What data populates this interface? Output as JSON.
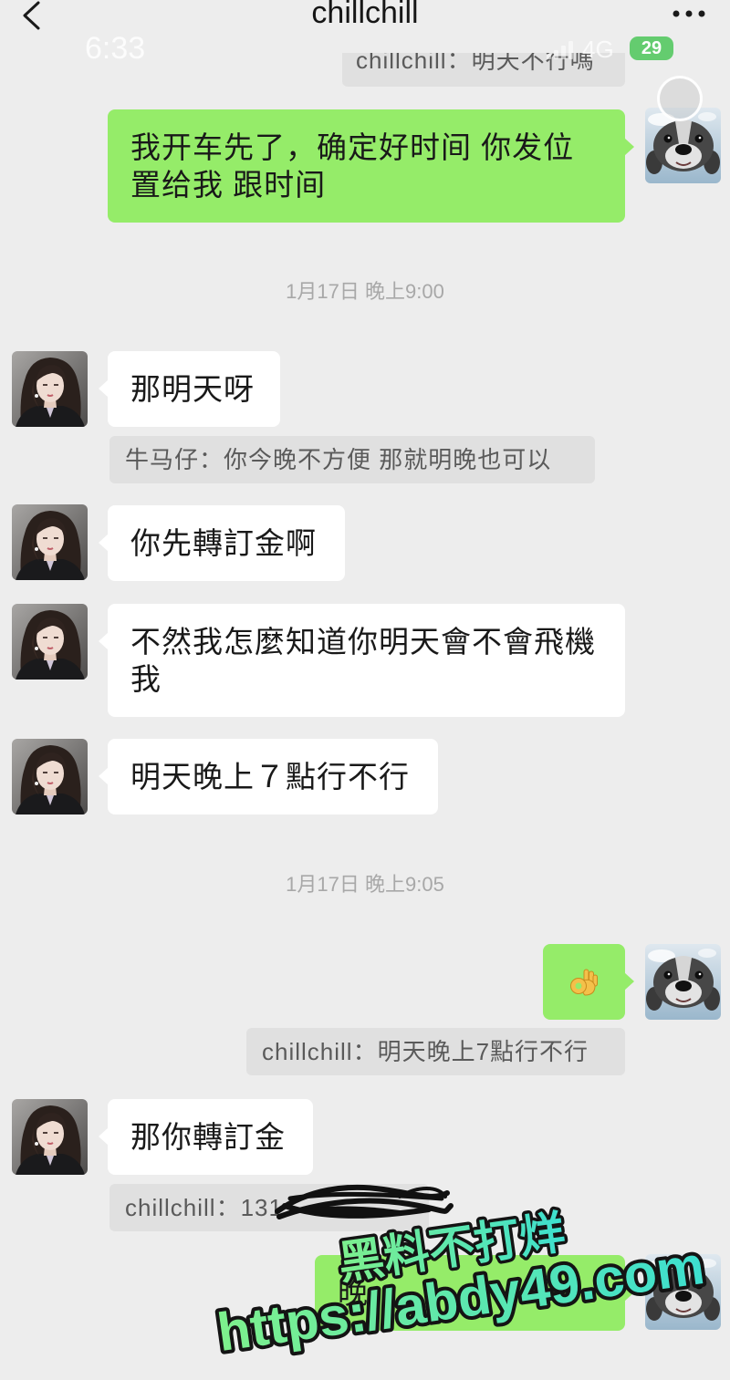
{
  "status_bar": {
    "time": "6:33",
    "network": "4G",
    "battery": "29",
    "signal_icon": "signal-bars-icon",
    "battery_icon": "battery-icon"
  },
  "header": {
    "title": "chillchill",
    "back_icon": "chevron-left-icon",
    "more_icon": "more-dots-icon"
  },
  "colors": {
    "background": "#ededed",
    "outgoing_bubble": "#95ec69",
    "incoming_bubble": "#ffffff",
    "quote_background": "#e0e0e0",
    "quote_text": "#5a5a5a",
    "timestamp_text": "#a8a8a8",
    "watermark_fill_start": "#7ef08c",
    "watermark_fill_end": "#3ddfcf",
    "watermark_outline": "#141414"
  },
  "messages": [
    {
      "quote": "chillchill：明天不行嗎"
    },
    {
      "outgoing": "我开车先了，确定好时间 你发位\n置给我 跟时间"
    },
    {
      "timestamp": "1月17日 晚上9:00"
    },
    {
      "incoming": "那明天呀"
    },
    {
      "quote": "牛马仔：你今晚不方便 那就明晚也可以"
    },
    {
      "incoming": "你先轉訂金啊"
    },
    {
      "incoming": "不然我怎麼知道你明天會不會飛機\n我"
    },
    {
      "incoming": "明天晚上７點行不行"
    },
    {
      "timestamp": "1月17日 晚上9:05"
    },
    {
      "outgoing_icon": "ok-hand-emoji-icon"
    },
    {
      "quote": "chillchill：明天晚上7點行不行"
    },
    {
      "incoming": "那你轉訂金"
    },
    {
      "quote": "chillchill：131",
      "redacted": true
    },
    {
      "outgoing": "晚",
      "obscured_by_watermark": true
    }
  ],
  "watermark": {
    "line1": "黑料不打烊",
    "line2": "https://abdy49.com"
  }
}
